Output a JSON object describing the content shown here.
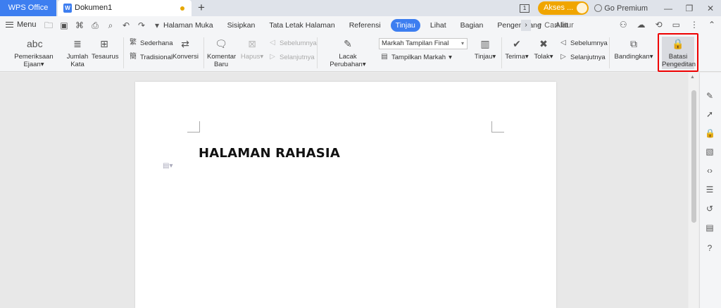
{
  "titlebar": {
    "app_tab": "WPS Office",
    "doc_tab": "Dokumen1",
    "new_tab": "+",
    "page_indicator": "1",
    "akses_label": "Akses ...",
    "go_premium": "Go Premium"
  },
  "menubar": {
    "menu_label": "Menu",
    "tabs": [
      "Halaman Muka",
      "Sisipkan",
      "Tata Letak Halaman",
      "Referensi",
      "Tinjau",
      "Lihat",
      "Bagian",
      "Pengembang",
      "Alat"
    ],
    "active_tab": "Tinjau",
    "search_placeholder": "Cari fitur"
  },
  "ribbon": {
    "spelling": "Pemeriksaan Ejaan",
    "word_count": "Jumlah Kata",
    "thesaurus": "Tesaurus",
    "simplified": "Sederhana",
    "traditional": "Tradisional",
    "convert": "Konversi",
    "new_comment": "Komentar Baru",
    "delete": "Hapus",
    "previous_comment": "Sebelumnya",
    "next_comment": "Selanjutnya",
    "track_changes": "Lacak Perubahan",
    "markup_display": "Markah Tampilan Final",
    "show_markup": "Tampilkan Markah",
    "review": "Tinjau",
    "accept": "Terima",
    "reject": "Tolak",
    "previous_change": "Sebelumnya",
    "next_change": "Selanjutnya",
    "compare": "Bandingkan",
    "restrict_editing": "Batasi Pengeditan"
  },
  "document": {
    "heading": "HALAMAN RAHASIA"
  }
}
